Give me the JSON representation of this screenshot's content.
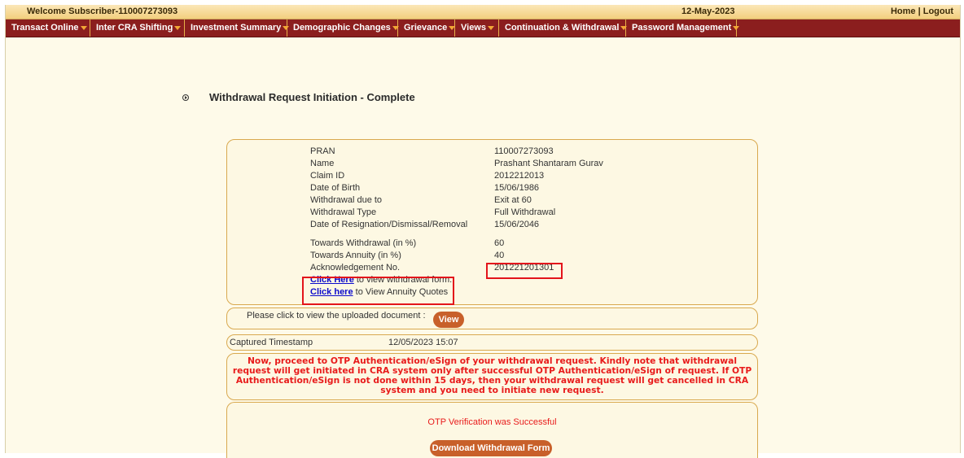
{
  "header": {
    "welcome": "Welcome Subscriber-110007273093",
    "date": "12-May-2023",
    "home": "Home",
    "separator": "|",
    "logout": "Logout"
  },
  "menu": [
    {
      "label": "Transact Online"
    },
    {
      "label": "Inter CRA Shifting"
    },
    {
      "label": "Investment Summary"
    },
    {
      "label": "Demographic Changes"
    },
    {
      "label": "Grievance"
    },
    {
      "label": "Views"
    },
    {
      "label": "Continuation & Withdrawal"
    },
    {
      "label": "Password Management"
    }
  ],
  "page_title": "Withdrawal Request Initiation - Complete",
  "details": [
    {
      "label": "PRAN",
      "value": "110007273093"
    },
    {
      "label": "Name",
      "value": "Prashant Shantaram Gurav"
    },
    {
      "label": "Claim ID",
      "value": "2012212013"
    },
    {
      "label": "Date of Birth",
      "value": "15/06/1986"
    },
    {
      "label": "Withdrawal due to",
      "value": "Exit at 60"
    },
    {
      "label": "Withdrawal Type",
      "value": "Full Withdrawal"
    },
    {
      "label": "Date of Resignation/Dismissal/Removal",
      "value": "15/06/2046"
    },
    {
      "label": "Towards Withdrawal (in %)",
      "value": "60"
    },
    {
      "label": "Towards Annuity (in %)",
      "value": "40"
    },
    {
      "label": "Acknowledgement No.",
      "value": "201221201301"
    }
  ],
  "links": {
    "withdrawal_form_link": "Click Here",
    "withdrawal_form_text": " to view withdrawal form.",
    "annuity_link": "Click here",
    "annuity_text": " to View Annuity Quotes"
  },
  "upload": {
    "text": "Please click to view the uploaded document :",
    "button": "View"
  },
  "timestamp": {
    "label": "Captured Timestamp",
    "value": "12/05/2023 15:07"
  },
  "notice": "Now, proceed to OTP Authentication/eSign of your withdrawal request. Kindly note that withdrawal request will get initiated in CRA system only after successful OTP Authentication/eSign of request. If OTP Authentication/eSign is not done within 15 days, then your withdrawal request will get cancelled in CRA system and you need to initiate new request.",
  "otp": {
    "message": "OTP Verification was Successful",
    "download_button": "Download Withdrawal Form"
  },
  "colors": {
    "menu_bg": "#8b1e1e",
    "accent_button": "#c8602a",
    "notice_red": "#e81b1b",
    "link_blue": "#0b0bcc",
    "highlight_red": "#e3141b"
  }
}
